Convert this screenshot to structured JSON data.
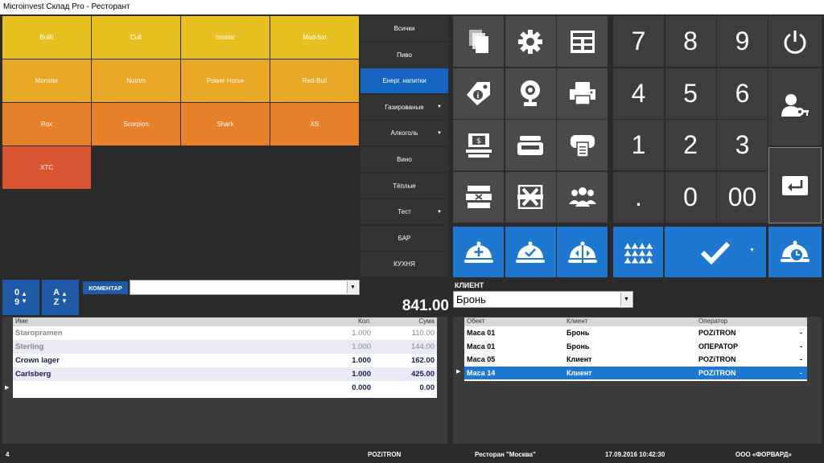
{
  "window": {
    "title": "Microinvest Склад Pro - Ресторант"
  },
  "products": [
    {
      "label": "Bullit",
      "color": "#e8c020"
    },
    {
      "label": "Cult",
      "color": "#e8c020"
    },
    {
      "label": "Isostar",
      "color": "#e8c020"
    },
    {
      "label": "Mad-bat",
      "color": "#e8c020"
    },
    {
      "label": "Monster",
      "color": "#e8a825"
    },
    {
      "label": "Nutrim",
      "color": "#e8a825"
    },
    {
      "label": "Power Horse",
      "color": "#e8a825"
    },
    {
      "label": "Red-Bull",
      "color": "#e8a825"
    },
    {
      "label": "Rox",
      "color": "#e8802a"
    },
    {
      "label": "Scorpion",
      "color": "#e8802a"
    },
    {
      "label": "Shark",
      "color": "#e8802a"
    },
    {
      "label": "XS",
      "color": "#e8802a"
    },
    {
      "label": "XTC",
      "color": "#d85530"
    }
  ],
  "categories": [
    {
      "label": "Всички",
      "dropdown": false,
      "active": false
    },
    {
      "label": "Пиво",
      "dropdown": false,
      "active": false
    },
    {
      "label": "Енерг. напитки",
      "dropdown": false,
      "active": true
    },
    {
      "label": "Газированые",
      "dropdown": true,
      "active": false
    },
    {
      "label": "Алкоголь",
      "dropdown": true,
      "active": false
    },
    {
      "label": "Вино",
      "dropdown": false,
      "active": false
    },
    {
      "label": "Тёплые",
      "dropdown": false,
      "active": false
    },
    {
      "label": "Тест",
      "dropdown": true,
      "active": false
    },
    {
      "label": "БАР",
      "dropdown": false,
      "active": false
    },
    {
      "label": "КУХНЯ",
      "dropdown": false,
      "active": false
    }
  ],
  "function_buttons": [
    "documents-icon",
    "settings-gear-icon",
    "cash-register-icon",
    "price-tag-info-icon",
    "webcam-icon",
    "printer-icon",
    "cashbox-icon",
    "scale-icon",
    "receipt-printer-icon",
    "cancel-line-icon",
    "void-icon",
    "group-users-icon"
  ],
  "blue_buttons": [
    "add-order-icon",
    "confirm-order-icon",
    "split-order-icon"
  ],
  "numpad": [
    "7",
    "8",
    "9",
    "4",
    "5",
    "6",
    "1",
    "2",
    "3",
    ".",
    "0",
    "00"
  ],
  "side_buttons": [
    "power-icon",
    "user-key-icon",
    "enter-icon"
  ],
  "bottom_blue": [
    "tables-grid-icon",
    "checkmark-icon",
    "timer-order-icon"
  ],
  "sort": {
    "numeric_top": "0",
    "numeric_bottom": "9",
    "alpha_top": "A",
    "alpha_bottom": "Z"
  },
  "comment": {
    "label": "КОМЕНТАР",
    "value": ""
  },
  "total": "841.00",
  "client": {
    "label": "КЛИЕНТ",
    "selected": "Бронь"
  },
  "order_table": {
    "headers": [
      "Име",
      "Кол.",
      "Сума"
    ],
    "rows": [
      {
        "name": "Staropramen",
        "qty": "1.000",
        "sum": "110.00",
        "muted": true
      },
      {
        "name": "Sterling",
        "qty": "1.000",
        "sum": "144.00",
        "muted": true
      },
      {
        "name": "Crown lager",
        "qty": "1.000",
        "sum": "162.00",
        "muted": false
      },
      {
        "name": "Carlsberg",
        "qty": "1.000",
        "sum": "425.00",
        "muted": false
      },
      {
        "name": "",
        "qty": "0.000",
        "sum": "0.00",
        "muted": false
      }
    ]
  },
  "tables_list": {
    "headers": [
      "Обект",
      "Клиент",
      "Оператор"
    ],
    "rows": [
      {
        "object": "Маса 01",
        "client": "Бронь",
        "operator": "POZiTRON",
        "flag": "-"
      },
      {
        "object": "Маса 01",
        "client": "Бронь",
        "operator": "ОПЕРАТОР",
        "flag": "-"
      },
      {
        "object": "Маса 05",
        "client": "Клиент",
        "operator": "POZiTRON",
        "flag": "-"
      },
      {
        "object": "Маса 14",
        "client": "Клиент",
        "operator": "POZiTRON",
        "flag": "-"
      }
    ]
  },
  "status": {
    "count": "4",
    "operator": "POZiTRON",
    "restaurant": "Ресторан \"Москва\"",
    "datetime": "17.09.2016 10:42:30",
    "company": "ООО «ФОРВАРД»"
  },
  "colors": {
    "accent": "#1e78d2",
    "selected_row": "#1e78d2"
  }
}
